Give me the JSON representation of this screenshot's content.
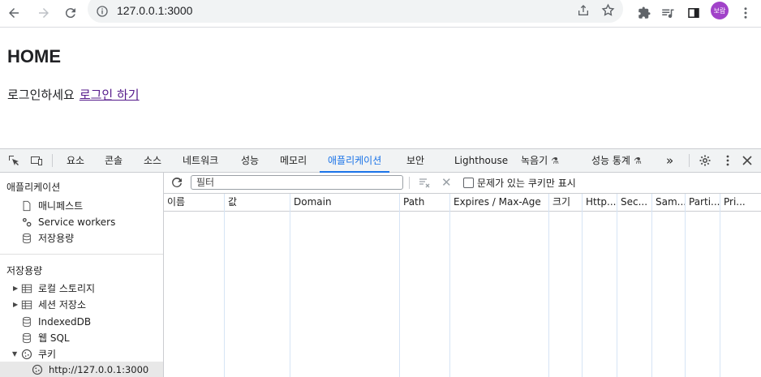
{
  "browser": {
    "url": "127.0.0.1:3000",
    "profile_initials": "보람",
    "profile_color": "#a142c9"
  },
  "page": {
    "title": "HOME",
    "message": "로그인하세요",
    "login_link": "로그인 하기"
  },
  "devtools": {
    "tabs": [
      "요소",
      "콘솔",
      "소스",
      "네트워크",
      "성능",
      "메모리",
      "애플리케이션",
      "보안",
      "Lighthouse",
      "녹음기",
      "성능 통계"
    ],
    "active_tab": "애플리케이션",
    "more_tabs": "»",
    "sidebar": {
      "application_header": "애플리케이션",
      "application_items": [
        "매니페스트",
        "Service workers",
        "저장용량"
      ],
      "storage_header": "저장용량",
      "storage_items": [
        "로컬 스토리지",
        "세션 저장소",
        "IndexedDB",
        "웹 SQL",
        "쿠키"
      ],
      "cookie_origin": "http://127.0.0.1:3000"
    },
    "filter": {
      "placeholder": "필터",
      "issues_only_label": "문제가 있는 쿠키만 표시"
    },
    "columns": [
      "이름",
      "값",
      "Domain",
      "Path",
      "Expires / Max-Age",
      "크기",
      "Http...",
      "Sec...",
      "Sam...",
      "Parti...",
      "Pri..."
    ],
    "accent_color": "#1a73e8"
  }
}
